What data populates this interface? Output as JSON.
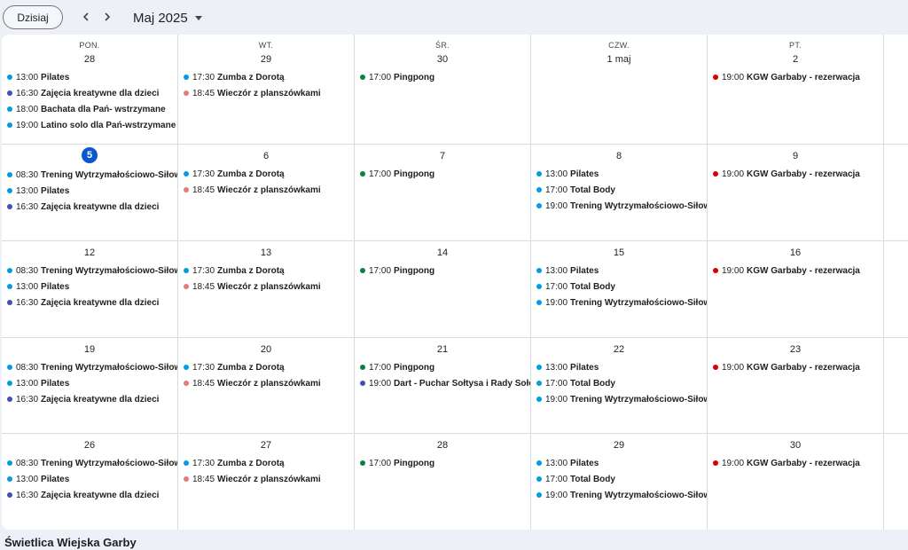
{
  "toolbar": {
    "today_label": "Dzisiaj",
    "month_title": "Maj 2025",
    "prev_icon": "chevron-left-icon",
    "next_icon": "chevron-right-icon"
  },
  "weekdays": [
    "PON.",
    "WT.",
    "ŚR.",
    "CZW.",
    "PT."
  ],
  "colors": {
    "blue_light": "#039be5",
    "navy": "#3f51b5",
    "salmon": "#e67c73",
    "green": "#0b8043",
    "red": "#d50000",
    "today_bg": "#0b57d0"
  },
  "weeks": [
    [
      {
        "day": "28",
        "events": [
          {
            "time": "13:00",
            "title": "Pilates",
            "color": "#039be5"
          },
          {
            "time": "16:30",
            "title": "Zajęcia kreatywne dla dzieci",
            "color": "#3f51b5"
          },
          {
            "time": "18:00",
            "title": "Bachata dla Pań- wstrzymane",
            "color": "#039be5"
          },
          {
            "time": "19:00",
            "title": "Latino solo dla Pań-wstrzymane",
            "color": "#039be5"
          }
        ]
      },
      {
        "day": "29",
        "events": [
          {
            "time": "17:30",
            "title": "Zumba z Dorotą",
            "color": "#039be5"
          },
          {
            "time": "18:45",
            "title": "Wieczór z planszówkami",
            "color": "#e67c73"
          }
        ]
      },
      {
        "day": "30",
        "events": [
          {
            "time": "17:00",
            "title": "Pingpong",
            "color": "#0b8043"
          }
        ]
      },
      {
        "day": "1 maj",
        "events": []
      },
      {
        "day": "2",
        "events": [
          {
            "time": "19:00",
            "title": "KGW Garbaby - rezerwacja",
            "color": "#d50000"
          }
        ]
      }
    ],
    [
      {
        "day": "5",
        "today": true,
        "events": [
          {
            "time": "08:30",
            "title": "Trening Wytrzymałościowo-Siłowy",
            "color": "#039be5"
          },
          {
            "time": "13:00",
            "title": "Pilates",
            "color": "#039be5"
          },
          {
            "time": "16:30",
            "title": "Zajęcia kreatywne dla dzieci",
            "color": "#3f51b5"
          }
        ]
      },
      {
        "day": "6",
        "events": [
          {
            "time": "17:30",
            "title": "Zumba z Dorotą",
            "color": "#039be5"
          },
          {
            "time": "18:45",
            "title": "Wieczór z planszówkami",
            "color": "#e67c73"
          }
        ]
      },
      {
        "day": "7",
        "events": [
          {
            "time": "17:00",
            "title": "Pingpong",
            "color": "#0b8043"
          }
        ]
      },
      {
        "day": "8",
        "events": [
          {
            "time": "13:00",
            "title": "Pilates",
            "color": "#039be5"
          },
          {
            "time": "17:00",
            "title": "Total Body",
            "color": "#039be5"
          },
          {
            "time": "19:00",
            "title": "Trening Wytrzymałościowo-Siłowy",
            "color": "#039be5"
          }
        ]
      },
      {
        "day": "9",
        "events": [
          {
            "time": "19:00",
            "title": "KGW Garbaby - rezerwacja",
            "color": "#d50000"
          }
        ]
      }
    ],
    [
      {
        "day": "12",
        "events": [
          {
            "time": "08:30",
            "title": "Trening Wytrzymałościowo-Siłowy",
            "color": "#039be5"
          },
          {
            "time": "13:00",
            "title": "Pilates",
            "color": "#039be5"
          },
          {
            "time": "16:30",
            "title": "Zajęcia kreatywne dla dzieci",
            "color": "#3f51b5"
          }
        ]
      },
      {
        "day": "13",
        "events": [
          {
            "time": "17:30",
            "title": "Zumba z Dorotą",
            "color": "#039be5"
          },
          {
            "time": "18:45",
            "title": "Wieczór z planszówkami",
            "color": "#e67c73"
          }
        ]
      },
      {
        "day": "14",
        "events": [
          {
            "time": "17:00",
            "title": "Pingpong",
            "color": "#0b8043"
          }
        ]
      },
      {
        "day": "15",
        "events": [
          {
            "time": "13:00",
            "title": "Pilates",
            "color": "#039be5"
          },
          {
            "time": "17:00",
            "title": "Total Body",
            "color": "#039be5"
          },
          {
            "time": "19:00",
            "title": "Trening Wytrzymałościowo-Siłowy",
            "color": "#039be5"
          }
        ]
      },
      {
        "day": "16",
        "events": [
          {
            "time": "19:00",
            "title": "KGW Garbaby - rezerwacja",
            "color": "#d50000"
          }
        ]
      }
    ],
    [
      {
        "day": "19",
        "events": [
          {
            "time": "08:30",
            "title": "Trening Wytrzymałościowo-Siłowy",
            "color": "#039be5"
          },
          {
            "time": "13:00",
            "title": "Pilates",
            "color": "#039be5"
          },
          {
            "time": "16:30",
            "title": "Zajęcia kreatywne dla dzieci",
            "color": "#3f51b5"
          }
        ]
      },
      {
        "day": "20",
        "events": [
          {
            "time": "17:30",
            "title": "Zumba z Dorotą",
            "color": "#039be5"
          },
          {
            "time": "18:45",
            "title": "Wieczór z planszówkami",
            "color": "#e67c73"
          }
        ]
      },
      {
        "day": "21",
        "events": [
          {
            "time": "17:00",
            "title": "Pingpong",
            "color": "#0b8043"
          },
          {
            "time": "19:00",
            "title": "Dart - Puchar Sołtysa i Rady Sołecki",
            "color": "#3f51b5"
          }
        ]
      },
      {
        "day": "22",
        "events": [
          {
            "time": "13:00",
            "title": "Pilates",
            "color": "#039be5"
          },
          {
            "time": "17:00",
            "title": "Total Body",
            "color": "#039be5"
          },
          {
            "time": "19:00",
            "title": "Trening Wytrzymałościowo-Siłowy",
            "color": "#039be5"
          }
        ]
      },
      {
        "day": "23",
        "events": [
          {
            "time": "19:00",
            "title": "KGW Garbaby - rezerwacja",
            "color": "#d50000"
          }
        ]
      }
    ],
    [
      {
        "day": "26",
        "events": [
          {
            "time": "08:30",
            "title": "Trening Wytrzymałościowo-Siłowy",
            "color": "#039be5"
          },
          {
            "time": "13:00",
            "title": "Pilates",
            "color": "#039be5"
          },
          {
            "time": "16:30",
            "title": "Zajęcia kreatywne dla dzieci",
            "color": "#3f51b5"
          }
        ]
      },
      {
        "day": "27",
        "events": [
          {
            "time": "17:30",
            "title": "Zumba z Dorotą",
            "color": "#039be5"
          },
          {
            "time": "18:45",
            "title": "Wieczór z planszówkami",
            "color": "#e67c73"
          }
        ]
      },
      {
        "day": "28",
        "events": [
          {
            "time": "17:00",
            "title": "Pingpong",
            "color": "#0b8043"
          }
        ]
      },
      {
        "day": "29",
        "events": [
          {
            "time": "13:00",
            "title": "Pilates",
            "color": "#039be5"
          },
          {
            "time": "17:00",
            "title": "Total Body",
            "color": "#039be5"
          },
          {
            "time": "19:00",
            "title": "Trening Wytrzymałościowo-Siłowy",
            "color": "#039be5"
          }
        ]
      },
      {
        "day": "30",
        "events": [
          {
            "time": "19:00",
            "title": "KGW Garbaby - rezerwacja",
            "color": "#d50000"
          }
        ]
      }
    ]
  ],
  "footer": {
    "calendar_name": "Świetlica Wiejska Garby"
  }
}
